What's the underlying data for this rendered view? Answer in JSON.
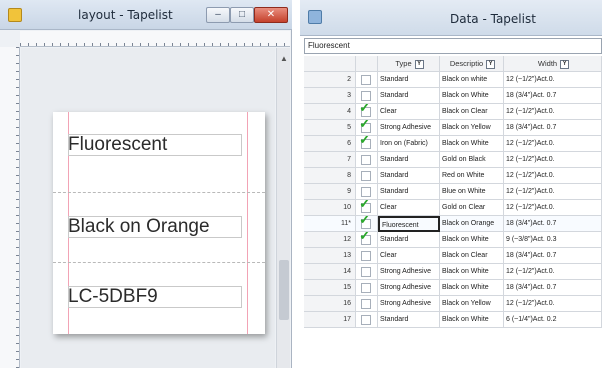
{
  "layout_window": {
    "title": "layout  - Tapelist",
    "label_lines": [
      "Fluorescent",
      "Black on Orange",
      "LC-5DBF9"
    ]
  },
  "data_window": {
    "title": "Data  - Tapelist",
    "edit_value": "Fluorescent",
    "columns": [
      "",
      "",
      "Type",
      "Descriptio",
      "Width"
    ],
    "rows": [
      {
        "num": "2",
        "checked": false,
        "type": "Standard",
        "desc": "Black on white",
        "width": "12 (~1/2\")Act.0."
      },
      {
        "num": "3",
        "checked": false,
        "type": "Standard",
        "desc": "Black on White",
        "width": "18 (3/4\")Act. 0.7"
      },
      {
        "num": "4",
        "checked": true,
        "type": "Clear",
        "desc": "Black on Clear",
        "width": "12 (~1/2\")Act.0."
      },
      {
        "num": "5",
        "checked": true,
        "type": "Strong Adhesive",
        "desc": "Black on Yellow",
        "width": "18 (3/4\")Act. 0.7"
      },
      {
        "num": "6",
        "checked": true,
        "type": "Iron on (Fabric)",
        "desc": "Black on White",
        "width": "12 (~1/2\")Act.0."
      },
      {
        "num": "7",
        "checked": false,
        "type": "Standard",
        "desc": "Gold on Black",
        "width": "12 (~1/2\")Act.0."
      },
      {
        "num": "8",
        "checked": false,
        "type": "Standard",
        "desc": "Red on White",
        "width": "12 (~1/2\")Act.0."
      },
      {
        "num": "9",
        "checked": false,
        "type": "Standard",
        "desc": "Blue on White",
        "width": "12 (~1/2\")Act.0."
      },
      {
        "num": "10",
        "checked": true,
        "type": "Clear",
        "desc": "Gold on Clear",
        "width": "12 (~1/2\")Act.0."
      },
      {
        "num": "11*",
        "checked": true,
        "type": "Fluorescent",
        "desc": "Black on Orange",
        "width": "18 (3/4\")Act. 0.7"
      },
      {
        "num": "12",
        "checked": true,
        "type": "Standard",
        "desc": "Black on White",
        "width": "9 (~3/8\")Act. 0.3"
      },
      {
        "num": "13",
        "checked": false,
        "type": "Clear",
        "desc": "Black on Clear",
        "width": "18 (3/4\")Act. 0.7"
      },
      {
        "num": "14",
        "checked": false,
        "type": "Strong Adhesive",
        "desc": "Black on White",
        "width": "12 (~1/2\")Act.0."
      },
      {
        "num": "15",
        "checked": false,
        "type": "Strong Adhesive",
        "desc": "Black on White",
        "width": "18 (3/4\")Act. 0.7"
      },
      {
        "num": "16",
        "checked": false,
        "type": "Strong Adhesive",
        "desc": "Black on Yellow",
        "width": "12 (~1/2\")Act.0."
      },
      {
        "num": "17",
        "checked": false,
        "type": "Standard",
        "desc": "Black on White",
        "width": "6 (~1/4\")Act. 0.2"
      }
    ]
  }
}
